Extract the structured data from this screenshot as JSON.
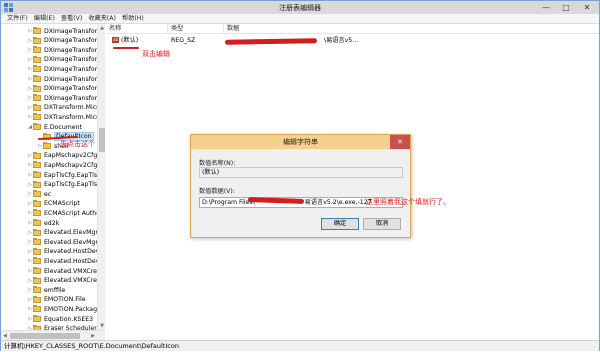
{
  "window": {
    "title": "注册表编辑器"
  },
  "window_controls": {
    "minimize": "—",
    "maximize": "□",
    "close": "✕"
  },
  "menu": [
    "文件(F)",
    "编辑(E)",
    "查看(V)",
    "收藏夹(A)",
    "帮助(H)"
  ],
  "tree": {
    "items": [
      {
        "label": "DXImageTransform",
        "arrow": "▷"
      },
      {
        "label": "DXImageTransform",
        "arrow": "▷"
      },
      {
        "label": "DXImageTransform",
        "arrow": "▷"
      },
      {
        "label": "DXImageTransform",
        "arrow": "▷"
      },
      {
        "label": "DXImageTransform",
        "arrow": "▷"
      },
      {
        "label": "DXImageTransform",
        "arrow": "▷"
      },
      {
        "label": "DXImageTransform",
        "arrow": "▷"
      },
      {
        "label": "DXImageTransform",
        "arrow": "▷"
      },
      {
        "label": "DXTransform.Micro",
        "arrow": "▷"
      },
      {
        "label": "DXTransform.Micro",
        "arrow": "▷"
      },
      {
        "label": "E.Document",
        "arrow": "◢"
      },
      {
        "label": "DefaultIcon",
        "arrow": "",
        "selected": true
      },
      {
        "label": "shell",
        "arrow": "▷"
      },
      {
        "label": "EapMschapv2Cfg.E",
        "arrow": "▷"
      },
      {
        "label": "EapMschapv2Cfg.E",
        "arrow": "▷"
      },
      {
        "label": "EapTlsCfg.EapTlsCf",
        "arrow": "▷"
      },
      {
        "label": "EapTlsCfg.EapTlsCf",
        "arrow": "▷"
      },
      {
        "label": "ec",
        "arrow": "▷"
      },
      {
        "label": "ECMAScript",
        "arrow": "▷"
      },
      {
        "label": "ECMAScript Author",
        "arrow": "▷"
      },
      {
        "label": "ed2k",
        "arrow": "▷"
      },
      {
        "label": "Elevated.ElevMgr",
        "arrow": "▷"
      },
      {
        "label": "Elevated.ElevMgr.1",
        "arrow": "▷"
      },
      {
        "label": "Elevated.HostDevice",
        "arrow": "▷"
      },
      {
        "label": "Elevated.HostDevice",
        "arrow": "▷"
      },
      {
        "label": "Elevated.VMXCreate",
        "arrow": "▷"
      },
      {
        "label": "Elevated.VMXCreate",
        "arrow": "▷"
      },
      {
        "label": "emffile",
        "arrow": "▷"
      },
      {
        "label": "EMOTION.File",
        "arrow": "▷"
      },
      {
        "label": "EMOTION.Package",
        "arrow": "▷"
      },
      {
        "label": "Equation.KSEE3",
        "arrow": "▷"
      },
      {
        "label": "Eraser Scheduler",
        "arrow": "▷"
      }
    ]
  },
  "scroll_arrows": {
    "up": "▲",
    "down": "▼",
    "left": "◀",
    "right": "▶"
  },
  "list": {
    "columns": [
      "名称",
      "类型",
      "数据"
    ],
    "rows": [
      {
        "icon": "ab",
        "name": "(默认)",
        "type": "REG_SZ",
        "data": "\\易语言v5..."
      }
    ]
  },
  "dialog": {
    "title": "编辑字符串",
    "close": "✕",
    "name_label": "数值名称(N):",
    "name_value": "(默认)",
    "data_label": "数值数据(V):",
    "data_value": "D:\\Program Files\\",
    "data_value_suffix": "易语言v5.2\\e.exe,-127",
    "ok": "确定",
    "cancel": "取消"
  },
  "annotations": {
    "double_click": "双击编辑",
    "first_click": "先点击这个",
    "fill_here": "这里照着我这个填就行了。"
  },
  "status": {
    "path": "计算机\\HKEY_CLASSES_ROOT\\E.Document\\DefaultIcon"
  },
  "colors": {
    "annotation": "#e02020",
    "dialog_title": "#f6d08c",
    "dialog_border": "#e0a64a",
    "selection": "#cce4f7"
  }
}
